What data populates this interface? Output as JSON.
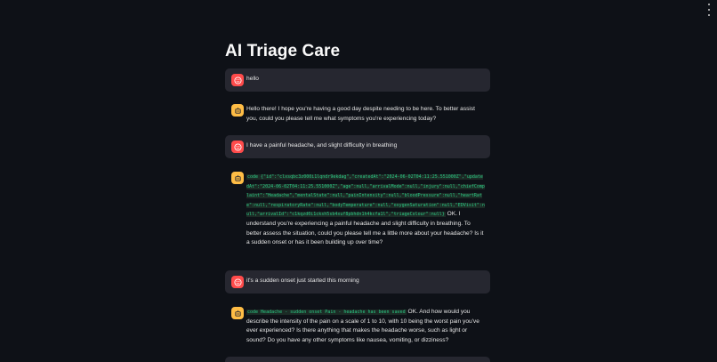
{
  "app": {
    "title": "AI Triage Care"
  },
  "messages": [
    {
      "role": "user",
      "text": "hello"
    },
    {
      "role": "assistant",
      "text": "Hello there! I hope you're having a good day despite needing to be here. To better assist you, could you please tell me what symptoms you're experiencing today?"
    },
    {
      "role": "user",
      "text": "I have a painful headache, and slight difficulty in breathing"
    },
    {
      "role": "assistant",
      "code": "code {\"id\":\"clxsqbc3z000i1lqndr9ekdag\",\"createdAt\":\"2024-06-02T04:11:25.551000Z\",\"updatedAt\":\"2024-06-02T04:11:25.551000Z\",\"age\":null,\"arrivalMode\":null,\"injury\":null,\"chiefComplaint\":\"Headache\",\"mentalState\":null,\"painIntensity\":null,\"bloodPressure\":null,\"heartRate\":null,\"respiratoryRate\":null,\"bodyTemperature\":null,\"oxygenSaturation\":null,\"EDVisit\":null,\"arrivalId\":\"c1kqzd0i1cksh5sb4xuf8pbhdn1h4kcfa1l\",\"triageColour\":null}",
      "text": "OK. I understand you're experiencing a painful headache and slight difficulty in breathing. To better assess the situation, could you please tell me a little more about your headache? Is it a sudden onset or has it been building up over time?"
    },
    {
      "role": "user",
      "text": "it's a sudden onset just started this morning"
    },
    {
      "role": "assistant",
      "code": "code Headache - sudden onset Pain - headache has been saved",
      "text": "OK. And how would you describe the intensity of the pain on a scale of 1 to 10, with 10 being the worst pain you've ever experienced? Is there anything that makes the headache worse, such as light or sound? Do you have any other symptoms like nausea, vomiting, or dizziness?"
    }
  ],
  "colors": {
    "user_avatar": "#ff4b4b",
    "assistant_avatar": "#ffbd45",
    "background": "#0e1117",
    "user_bubble": "#262730",
    "code_text": "#2bcc86"
  },
  "icons": {
    "user": "smiley-face-icon",
    "assistant": "robot-icon",
    "menu": "kebab-menu-icon"
  }
}
